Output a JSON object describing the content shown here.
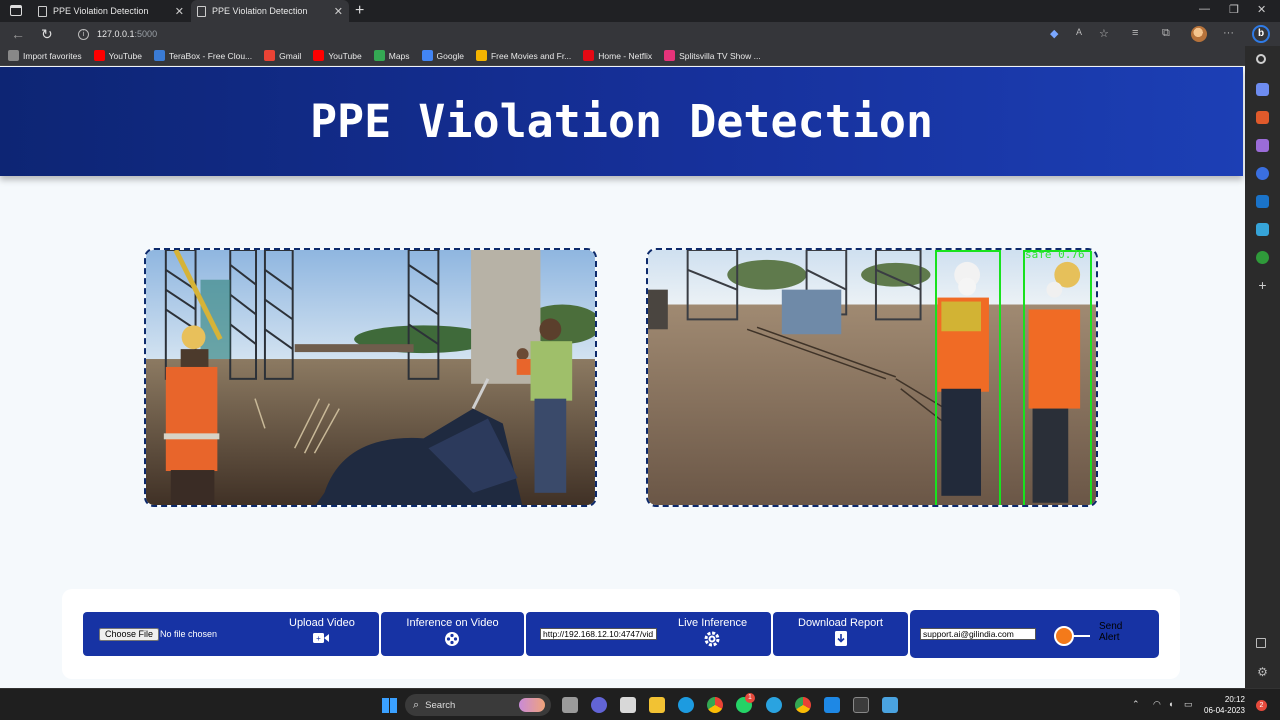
{
  "browser": {
    "tabs": [
      {
        "title": "PPE Violation Detection",
        "close": "✕"
      },
      {
        "title": "PPE Violation Detection",
        "close": "✕"
      }
    ],
    "new_tab": "+",
    "url_host": "127.0.0.1",
    "url_port": ":5000",
    "bookmarks": [
      {
        "label": "Import favorites",
        "color": "#888888"
      },
      {
        "label": "YouTube",
        "color": "#ff0000"
      },
      {
        "label": "TeraBox - Free Clou...",
        "color": "#3a7bd5"
      },
      {
        "label": "Gmail",
        "color": "#ea4335"
      },
      {
        "label": "YouTube",
        "color": "#ff0000"
      },
      {
        "label": "Maps",
        "color": "#34a853"
      },
      {
        "label": "Google",
        "color": "#4285f4"
      },
      {
        "label": "Free Movies and Fr...",
        "color": "#f4b400"
      },
      {
        "label": "Home - Netflix",
        "color": "#e50914"
      },
      {
        "label": "Splitsvilla TV Show ...",
        "color": "#e6337a"
      }
    ]
  },
  "app": {
    "title": "PPE Violation Detection",
    "detection_label": "safe  0.76",
    "controls": {
      "choose_file": "Choose File",
      "file_status": "No file chosen",
      "upload_video": "Upload Video",
      "inference_on_video": "Inference on Video",
      "stream_url": "http://192.168.12.10:4747/vid",
      "live_inference": "Live Inference",
      "download_report": "Download Report",
      "alert_email": "support.ai@gilindia.com",
      "send_alert": "Send Alert",
      "send_alert_on": true
    },
    "colors": {
      "header": "#16309a",
      "control": "#1733a4",
      "detection_box": "#18e21e",
      "toggle": "#f47a1a"
    }
  },
  "taskbar": {
    "search": "Search",
    "time": "20:12",
    "date": "06-04-2023",
    "notifications": "2",
    "whatsapp_badge": "1"
  }
}
